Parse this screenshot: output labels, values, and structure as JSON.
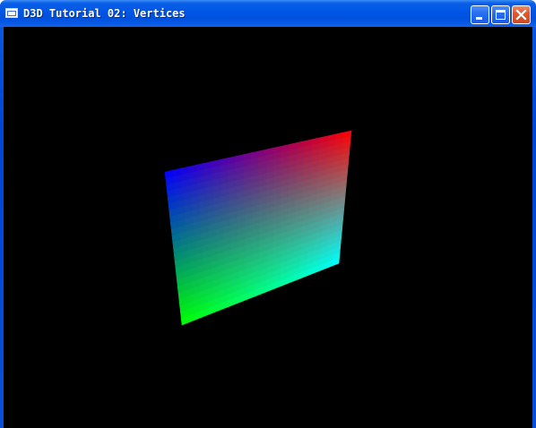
{
  "window": {
    "title": "D3D Tutorial 02: Vertices",
    "icon": "window-icon",
    "controls": {
      "minimize": "minimize-icon",
      "maximize": "maximize-icon",
      "close": "close-icon"
    }
  },
  "scene": {
    "background": "#000000",
    "quad_vertex_colors": {
      "top_left": "#0000ff",
      "top_right": "#ff0000",
      "bottom_left": "#00ff00",
      "bottom_right": "#00ffff"
    }
  }
}
